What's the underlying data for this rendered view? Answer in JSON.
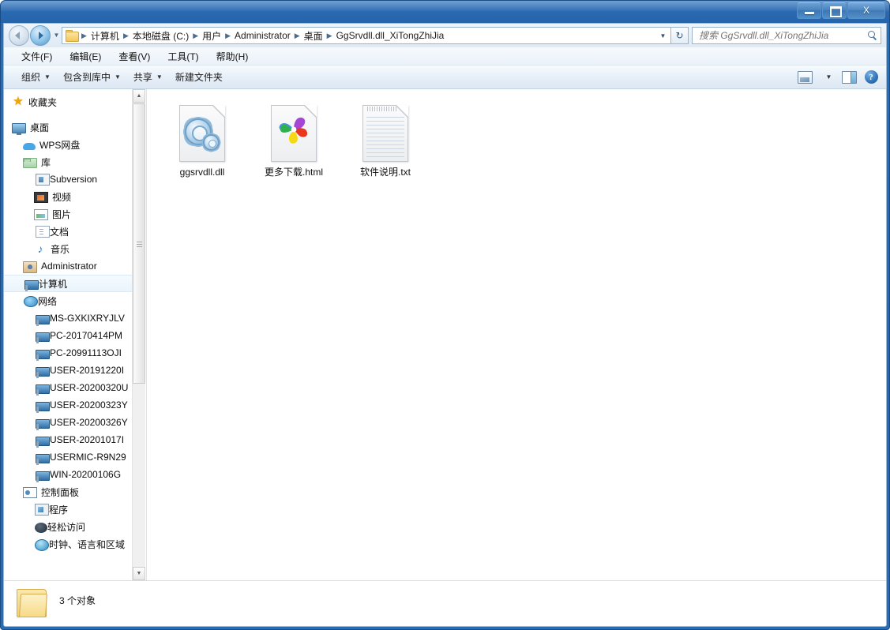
{
  "titlebar": {
    "minimize_label": "最小化",
    "maximize_label": "最大化",
    "close_label": "X"
  },
  "address": {
    "back_label": "后退",
    "forward_label": "前进",
    "history_caret": "▼",
    "crumbs": [
      "计算机",
      "本地磁盘 (C:)",
      "用户",
      "Administrator",
      "桌面",
      "GgSrvdll.dll_XiTongZhiJia"
    ],
    "separator": "▶",
    "dropdown_caret": "▼",
    "refresh_label": "↻"
  },
  "search": {
    "placeholder": "搜索 GgSrvdll.dll_XiTongZhiJia",
    "value": ""
  },
  "menubar": {
    "items": [
      {
        "label": "文件(F)"
      },
      {
        "label": "编辑(E)"
      },
      {
        "label": "查看(V)"
      },
      {
        "label": "工具(T)"
      },
      {
        "label": "帮助(H)"
      }
    ]
  },
  "toolbar": {
    "items": [
      {
        "label": "组织",
        "caret": "▼"
      },
      {
        "label": "包含到库中",
        "caret": "▼"
      },
      {
        "label": "共享",
        "caret": "▼"
      },
      {
        "label": "新建文件夹",
        "caret": ""
      }
    ],
    "view_caret": "▼",
    "help_glyph": "?"
  },
  "navpane": {
    "items": [
      {
        "label": "收藏夹",
        "icon": "star-icon",
        "level": 0,
        "selected": false
      },
      {
        "label": "",
        "icon": "",
        "level": 0,
        "spacer": true
      },
      {
        "label": "桌面",
        "icon": "desktop-icon",
        "level": 0,
        "selected": false
      },
      {
        "label": "WPS网盘",
        "icon": "cloud-icon",
        "level": 1,
        "selected": false
      },
      {
        "label": "库",
        "icon": "library-icon",
        "level": 1,
        "selected": false
      },
      {
        "label": "Subversion",
        "icon": "subversion-icon",
        "level": 2,
        "selected": false
      },
      {
        "label": "视频",
        "icon": "video-icon",
        "level": 2,
        "selected": false
      },
      {
        "label": "图片",
        "icon": "picture-icon",
        "level": 2,
        "selected": false
      },
      {
        "label": "文档",
        "icon": "document-icon",
        "level": 2,
        "selected": false
      },
      {
        "label": "音乐",
        "icon": "music-icon",
        "level": 2,
        "selected": false
      },
      {
        "label": "Administrator",
        "icon": "user-icon",
        "level": 1,
        "selected": false
      },
      {
        "label": "计算机",
        "icon": "computer-icon",
        "level": 1,
        "selected": true
      },
      {
        "label": "网络",
        "icon": "network-icon",
        "level": 1,
        "selected": false
      },
      {
        "label": "MS-GXKIXRYJLV",
        "icon": "pc-icon",
        "level": 2,
        "selected": false
      },
      {
        "label": "PC-20170414PM",
        "icon": "pc-icon",
        "level": 2,
        "selected": false
      },
      {
        "label": "PC-20991113OJI",
        "icon": "pc-icon",
        "level": 2,
        "selected": false
      },
      {
        "label": "USER-20191220I",
        "icon": "pc-icon",
        "level": 2,
        "selected": false
      },
      {
        "label": "USER-20200320U",
        "icon": "pc-icon",
        "level": 2,
        "selected": false
      },
      {
        "label": "USER-20200323Y",
        "icon": "pc-icon",
        "level": 2,
        "selected": false
      },
      {
        "label": "USER-20200326Y",
        "icon": "pc-icon",
        "level": 2,
        "selected": false
      },
      {
        "label": "USER-20201017I",
        "icon": "pc-icon",
        "level": 2,
        "selected": false
      },
      {
        "label": "USERMIC-R9N29",
        "icon": "pc-icon",
        "level": 2,
        "selected": false
      },
      {
        "label": "WIN-20200106G",
        "icon": "pc-icon",
        "level": 2,
        "selected": false
      },
      {
        "label": "控制面板",
        "icon": "control-panel-icon",
        "level": 1,
        "selected": false
      },
      {
        "label": "程序",
        "icon": "programs-icon",
        "level": 2,
        "selected": false
      },
      {
        "label": "轻松访问",
        "icon": "ease-of-access-icon",
        "level": 2,
        "selected": false
      },
      {
        "label": "时钟、语言和区域",
        "icon": "clock-region-icon",
        "level": 2,
        "selected": false
      }
    ]
  },
  "files": [
    {
      "name": "ggsrvdll.dll",
      "icon": "dll-gears-icon"
    },
    {
      "name": "更多下载.html",
      "icon": "html-pinwheel-icon"
    },
    {
      "name": "软件说明.txt",
      "icon": "txt-document-icon"
    }
  ],
  "statusbar": {
    "text": "3 个对象",
    "folder_icon": "folder-icon"
  },
  "colors": {
    "titlebar": "#2a69b0",
    "accent": "#2f74b8",
    "selection": "#e9f4fc",
    "folder_yellow": "#f0cf74"
  }
}
